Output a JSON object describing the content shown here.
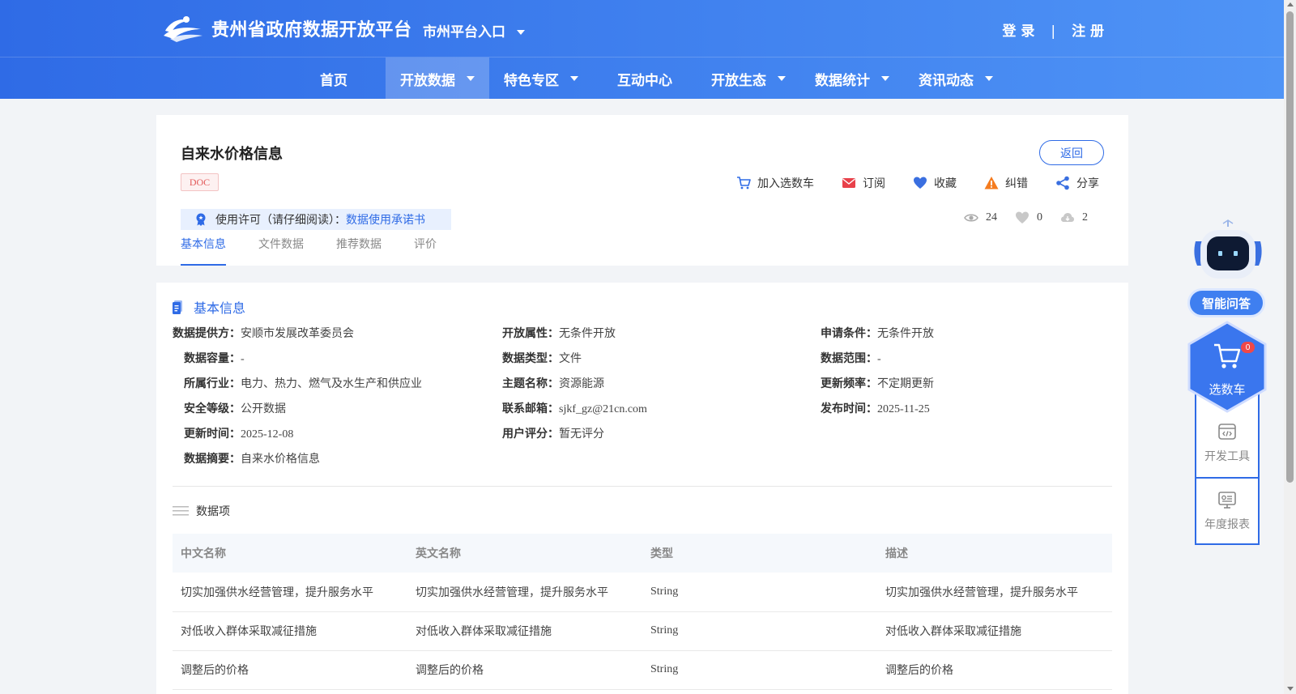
{
  "header": {
    "site_title": "贵州省政府数据开放平台",
    "city_entry": "市州平台入口",
    "login": "登 录",
    "separator": "|",
    "register": "注 册"
  },
  "nav": {
    "items": [
      {
        "label": "首页",
        "has_dropdown": false
      },
      {
        "label": "开放数据",
        "has_dropdown": true,
        "active": true
      },
      {
        "label": "特色专区",
        "has_dropdown": true
      },
      {
        "label": "互动中心",
        "has_dropdown": false
      },
      {
        "label": "开放生态",
        "has_dropdown": true
      },
      {
        "label": "数据统计",
        "has_dropdown": true
      },
      {
        "label": "资讯动态",
        "has_dropdown": true
      }
    ]
  },
  "dataset": {
    "title": "自来水价格信息",
    "format_badge": "DOC",
    "license_prefix": "使用许可（请仔细阅读）：",
    "license_link": "数据使用承诺书",
    "back_label": "返回",
    "actions": {
      "cart": "加入选数车",
      "subscribe": "订阅",
      "favorite": "收藏",
      "report": "纠错",
      "share": "分享"
    },
    "stats": {
      "views": "24",
      "likes": "0",
      "downloads": "2"
    },
    "tabs": [
      "基本信息",
      "文件数据",
      "推荐数据",
      "评价"
    ]
  },
  "basic_info": {
    "heading": "基本信息",
    "fields": {
      "provider": {
        "k": "数据提供方：",
        "v": "安顺市发展改革委员会"
      },
      "open_attr": {
        "k": "开放属性：",
        "v": "无条件开放"
      },
      "apply_cond": {
        "k": "申请条件：",
        "v": "无条件开放"
      },
      "capacity": {
        "k": "数据容量：",
        "v": "-"
      },
      "data_type": {
        "k": "数据类型：",
        "v": "文件"
      },
      "scope": {
        "k": "数据范围：",
        "v": "-"
      },
      "industry": {
        "k": "所属行业：",
        "v": "电力、热力、燃气及水生产和供应业"
      },
      "topic": {
        "k": "主题名称：",
        "v": "资源能源"
      },
      "frequency": {
        "k": "更新频率：",
        "v": "不定期更新"
      },
      "security": {
        "k": "安全等级：",
        "v": "公开数据"
      },
      "email": {
        "k": "联系邮箱：",
        "v": "sjkf_gz@21cn.com"
      },
      "publish_time": {
        "k": "发布时间：",
        "v": "2025-11-25"
      },
      "update_time": {
        "k": "更新时间：",
        "v": "2025-12-08"
      },
      "rating": {
        "k": "用户评分：",
        "v": "暂无评分"
      },
      "summary": {
        "k": "数据摘要：",
        "v": "自来水价格信息"
      }
    }
  },
  "data_items": {
    "heading": "数据项",
    "columns": [
      "中文名称",
      "英文名称",
      "类型",
      "描述"
    ],
    "rows": [
      [
        "切实加强供水经营管理，提升服务水平",
        "切实加强供水经营管理，提升服务水平",
        "String",
        "切实加强供水经营管理，提升服务水平"
      ],
      [
        "对低收入群体采取减征措施",
        "对低收入群体采取减征措施",
        "String",
        "对低收入群体采取减征措施"
      ],
      [
        "调整后的价格",
        "调整后的价格",
        "String",
        "调整后的价格"
      ]
    ]
  },
  "sidebar": {
    "qa_label": "智能问答",
    "cart_label": "选数车",
    "cart_count": "0",
    "dev_tools": "开发工具",
    "annual_report": "年度报表"
  },
  "colors": {
    "primary": "#2f6be6",
    "header_gradient_end": "#4f94f6",
    "danger": "#f04848"
  }
}
